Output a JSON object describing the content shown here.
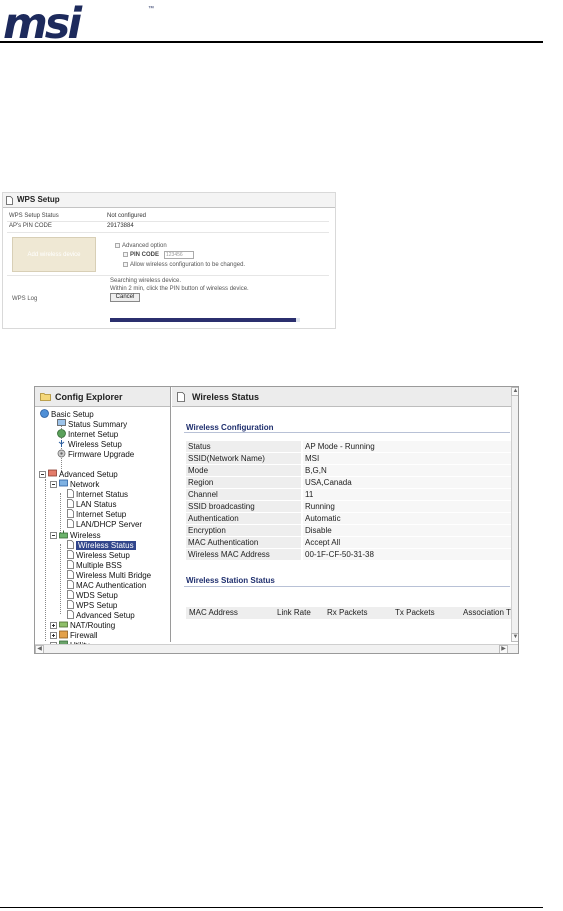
{
  "brand": {
    "logo": "msi",
    "tm": "™"
  },
  "wps": {
    "title": "WPS Setup",
    "rows": [
      {
        "label": "WPS Setup Status",
        "value": "Not configured"
      },
      {
        "label": "AP's PIN CODE",
        "value": "29173884"
      }
    ],
    "device_box": "Add wireless device",
    "advanced_option": "Advanced option",
    "pin_code_label": "PIN CODE",
    "pin_code_value": "123456",
    "allow_config": "Allow wireless configuration to be changed.",
    "log_label": "WPS Log",
    "searching": "Searching wireless device.",
    "instruction": "Within 2 min, click the PIN button of wireless device.",
    "cancel_label": "Cancel",
    "progress": 0.98
  },
  "explorer": {
    "title": "Config Explorer",
    "basic_setup": "Basic Setup",
    "status_summary": "Status Summary",
    "internet_setup": "Internet Setup",
    "wireless_setup": "Wireless Setup",
    "firmware_upgrade": "Firmware Upgrade",
    "advanced_setup": "Advanced Setup",
    "network": "Network",
    "internet_status": "Internet Status",
    "lan_status": "LAN Status",
    "net_internet_setup": "Internet Setup",
    "lan_dhcp": "LAN/DHCP Server",
    "wireless": "Wireless",
    "wireless_status": "Wireless Status",
    "w_wireless_setup": "Wireless Setup",
    "multiple_bss": "Multiple BSS",
    "wireless_multi_bridge": "Wireless Multi Bridge",
    "mac_auth": "MAC Authentication",
    "wds_setup": "WDS Setup",
    "wps_setup": "WPS Setup",
    "w_advanced_setup": "Advanced Setup",
    "nat_routing": "NAT/Routing",
    "firewall": "Firewall",
    "utility": "Utility"
  },
  "status": {
    "title": "Wireless Status",
    "config_heading": "Wireless Configuration",
    "rows": [
      {
        "label": "Status",
        "value": "AP Mode - Running"
      },
      {
        "label": "SSID(Network Name)",
        "value": "MSI"
      },
      {
        "label": "Mode",
        "value": "B,G,N"
      },
      {
        "label": "Region",
        "value": "USA,Canada"
      },
      {
        "label": "Channel",
        "value": "11"
      },
      {
        "label": "SSID broadcasting",
        "value": "Running"
      },
      {
        "label": "Authentication",
        "value": "Automatic"
      },
      {
        "label": "Encryption",
        "value": "Disable"
      },
      {
        "label": "MAC Authentication",
        "value": "Accept All"
      },
      {
        "label": "Wireless MAC Address",
        "value": "00-1F-CF-50-31-38"
      }
    ],
    "station_heading": "Wireless Station Status",
    "table_headers": [
      "MAC Address",
      "Link Rate",
      "Rx Packets",
      "Tx Packets",
      "Association T"
    ]
  }
}
